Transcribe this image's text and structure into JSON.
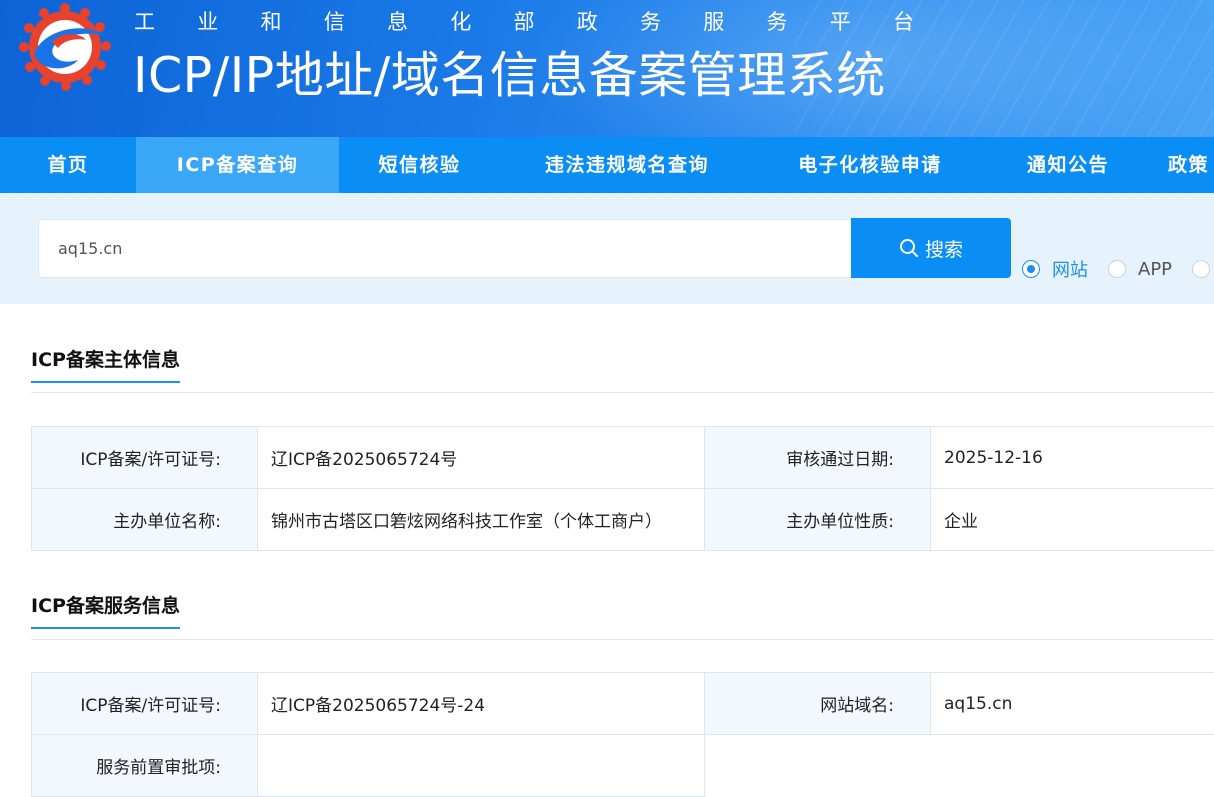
{
  "header": {
    "ministry_chars": [
      "工",
      "业",
      "和",
      "信",
      "息",
      "化",
      "部",
      "政",
      "务",
      "服",
      "务",
      "平",
      "台"
    ],
    "system_title": "ICP/IP地址/域名信息备案管理系统",
    "logo_icon": "miit-gear-logo-icon",
    "colors": {
      "header_from": "#0d63d6",
      "header_to": "#4aa3f5",
      "logo_red": "#e8412d",
      "logo_blue": "#1a73e8"
    }
  },
  "nav": {
    "items": [
      {
        "label": "首页",
        "active": false
      },
      {
        "label": "ICP备案查询",
        "active": true
      },
      {
        "label": "短信核验",
        "active": false
      },
      {
        "label": "违法违规域名查询",
        "active": false
      },
      {
        "label": "电子化核验申请",
        "active": false
      },
      {
        "label": "通知公告",
        "active": false
      },
      {
        "label": "政策",
        "active": false
      }
    ],
    "colors": {
      "bar": "#0a8ef5",
      "active": "#39a6f7"
    }
  },
  "search": {
    "value": "aq15.cn",
    "button_label": "搜索",
    "button_icon": "search-icon",
    "options": [
      {
        "label": "网站",
        "checked": true
      },
      {
        "label": "APP",
        "checked": false
      },
      {
        "label": "",
        "checked": false
      }
    ]
  },
  "subject": {
    "title": "ICP备案主体信息",
    "rows": [
      {
        "label1": "ICP备案/许可证号:",
        "value1": "辽ICP备2025065724号",
        "label2": "审核通过日期:",
        "value2": "2025-12-16"
      },
      {
        "label1": "主办单位名称:",
        "value1": "锦州市古塔区口箬炫网络科技工作室（个体工商户）",
        "label2": "主办单位性质:",
        "value2": "企业"
      }
    ]
  },
  "service": {
    "title": "ICP备案服务信息",
    "rows": [
      {
        "label1": "ICP备案/许可证号:",
        "value1": "辽ICP备2025065724号-24",
        "label2": "网站域名:",
        "value2": "aq15.cn"
      },
      {
        "label1": "服务前置审批项:",
        "value1": ""
      }
    ]
  },
  "accent_color": "#1a8ff5"
}
